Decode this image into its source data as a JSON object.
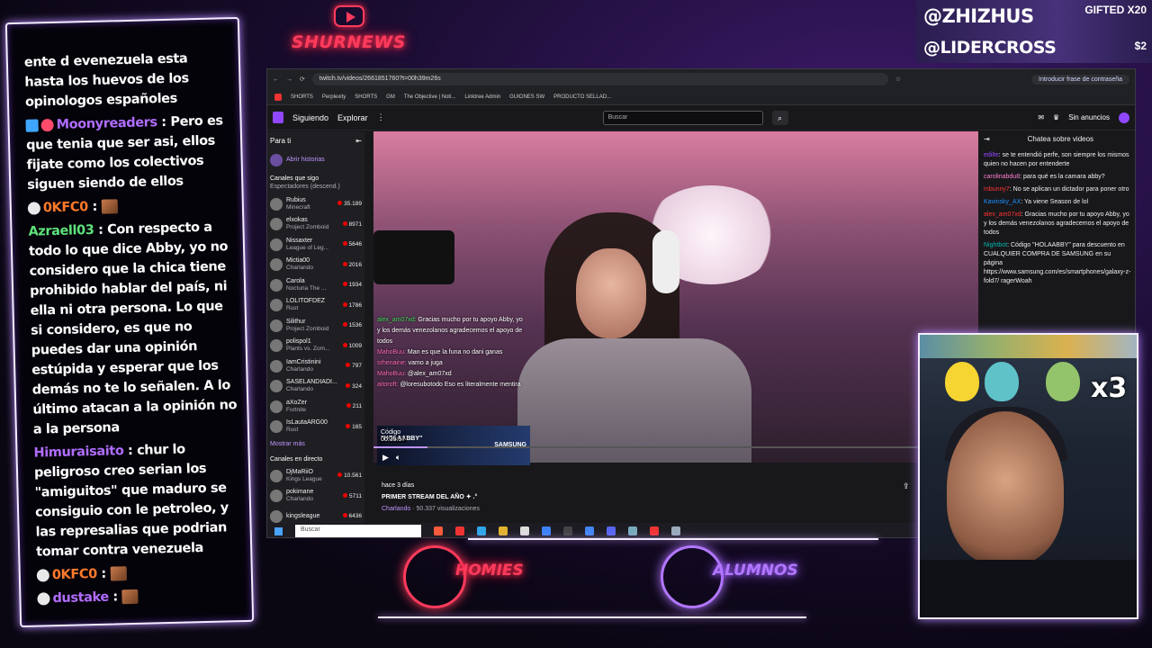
{
  "overlay": {
    "brand": "SHURNEWS",
    "top_right": {
      "line1": "@ZHIZHUS",
      "line2": "@LIDERCROSS",
      "gift": "GIFTED X20",
      "amount": "$2"
    },
    "bottom_left_logo": "HOMIES",
    "bottom_right_logo": "ALUMNOS",
    "webcam_badge": "x3"
  },
  "stream_chat": [
    {
      "user": "",
      "text": "ente d evenezuela esta hasta los huevos de los opinologos españoles"
    },
    {
      "user": "Moonyreaders",
      "text": ": Pero es que tenia que ser asi, ellos fijate como los colectivos siguen siendo de ellos"
    },
    {
      "user": "0KFC0",
      "text": ":"
    },
    {
      "user": "Azraell03",
      "text": ": Con respecto a todo lo que dice Abby, yo no considero que la chica tiene prohibido hablar del país, ni ella ni otra persona. Lo que si considero, es que no puedes dar una opinión estúpida y esperar que los demás no te lo señalen. A lo último atacan a la opinión no a la persona"
    },
    {
      "user": "Himuraisaito",
      "text": ": chur lo peligroso creo serian los \"amiguitos\" que maduro se consiguio con le petroleo, y las represalias que podrian tomar contra venezuela"
    },
    {
      "user": "0KFC0",
      "text": ":"
    },
    {
      "user": "dustake",
      "text": ":"
    }
  ],
  "browser": {
    "url": "twitch.tv/videos/2661851760?t=00h39m26s",
    "password_hint": "Introducir frase de contraseña",
    "bookmarks": [
      "SHORTS",
      "Perplexity",
      "SHORTS",
      "GM",
      "The Objective | Noti...",
      "Linktree Admin",
      "GUIONES SW",
      "PRODUCTO SELLAD..."
    ]
  },
  "twitch": {
    "nav": {
      "following": "Siguiendo",
      "explore": "Explorar"
    },
    "search_placeholder": "Buscar",
    "no_ads": "Sin anuncios",
    "sidebar": {
      "for_you": "Para ti",
      "open_stories": "Abrir historias",
      "followed_header": "Canales que sigo",
      "sort": "Espectadores (descend.)",
      "channels": [
        {
          "name": "Rubius",
          "game": "Minecraft",
          "viewers": "35.189"
        },
        {
          "name": "elxokas",
          "game": "Project Zomboid",
          "viewers": "8971"
        },
        {
          "name": "Nissaxter",
          "game": "League of Leg...",
          "viewers": "5646"
        },
        {
          "name": "Mictia00",
          "game": "Charlando",
          "viewers": "2016"
        },
        {
          "name": "Carola",
          "game": "Nocturia The ...",
          "viewers": "1934"
        },
        {
          "name": "LOLITOFDEZ",
          "game": "Rust",
          "viewers": "1786"
        },
        {
          "name": "Silithur",
          "game": "Project Zomboid",
          "viewers": "1536"
        },
        {
          "name": "polispol1",
          "game": "Plants vs. Zom...",
          "viewers": "1009"
        },
        {
          "name": "IamCristinini",
          "game": "Charlando",
          "viewers": "797"
        },
        {
          "name": "SASELANDIADI...",
          "game": "Charlando",
          "viewers": "324"
        },
        {
          "name": "aXoZer",
          "game": "Fortnite",
          "viewers": "211"
        },
        {
          "name": "IsLautaARG00",
          "game": "Rust",
          "viewers": "165"
        }
      ],
      "show_more": "Mostrar más",
      "live_header": "Canales en directo",
      "live": [
        {
          "name": "DjMaRiiO",
          "game": "Kings League",
          "viewers": "10.561"
        },
        {
          "name": "pokimane",
          "game": "Charlando",
          "viewers": "5711"
        },
        {
          "name": "kingsleague",
          "game": "",
          "viewers": "6436"
        }
      ]
    },
    "video": {
      "chat_lines": [
        {
          "user": "alex_am07xd:",
          "text": "Gracias mucho por tu apoyo Abby, yo y los demás venezolanos agradecemos el apoyo de todos"
        },
        {
          "user": "MahoBuu:",
          "text": "Man es que la funa no dani ganas"
        },
        {
          "user": "srhenaine:",
          "text": "vamo a juga"
        },
        {
          "user": "MahoBuu:",
          "text": "@alex_am07xd"
        },
        {
          "user": "aitoroft:",
          "text": "@loresubotodo Eso es literalmente mentira"
        }
      ],
      "promo_label": "Código",
      "promo_code": "\"HOLAABBY\"",
      "promo_brand": "SAMSUNG",
      "timestamp": "00:39:57",
      "progress": 0.09
    },
    "info": {
      "ago": "hace 3 días",
      "title": "PRIMER STREAM DEL AÑO ✦ .°",
      "category": "Charlando",
      "views": "· 50.337 visualizaciones"
    },
    "chat": {
      "header": "Chatea sobre videos",
      "messages": [
        {
          "user": "edilte",
          "text": ": se te entendió perfe, son siempre los mismos quien no hacen por entenderte",
          "cls": "u1"
        },
        {
          "user": "carolinabdu8",
          "text": ": para qué es la camara abby?",
          "cls": "u2"
        },
        {
          "user": "mbunny7",
          "text": ": No se aplican un dictador para poner otro",
          "cls": "u3"
        },
        {
          "user": "Kavinsky_AX",
          "text": ": Ya viene Season de lol",
          "cls": "u4"
        },
        {
          "user": "alex_am07xd",
          "text": ": Gracias mucho por tu apoyo Abby, yo y los demás venezolanos agradecemos el apoyo de todos",
          "cls": "u3"
        },
        {
          "user": "Nightbot",
          "text": ": Código \"HOLAABBY\" para descuento en CUALQUIER COMPRA DE SAMSUNG en su página https://www.samsung.com/es/smartphones/galaxy-z-fold7/ ragerWoah",
          "cls": "u5"
        }
      ]
    },
    "taskbar_search": "Buscar"
  }
}
